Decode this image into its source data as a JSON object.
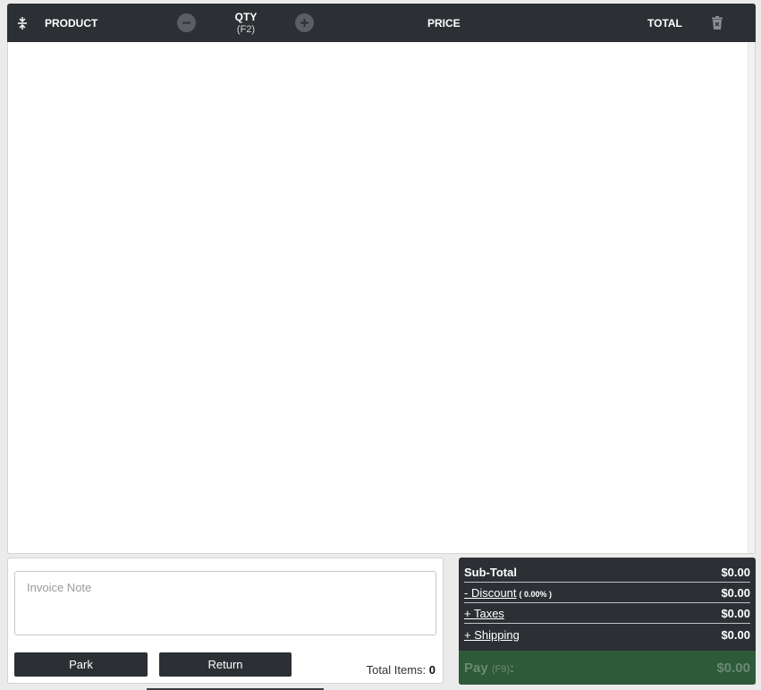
{
  "cart": {
    "header": {
      "product": "PRODUCT",
      "qty": "QTY",
      "qty_shortcut": "(F2)",
      "price": "PRICE",
      "total": "TOTAL"
    },
    "icons": {
      "collapse": "expand-collapse-icon",
      "qty_minus": "minus-circle-icon",
      "qty_plus": "plus-circle-icon",
      "clear": "trash-icon"
    }
  },
  "notes": {
    "placeholder": "Invoice Note",
    "park_label": "Park",
    "return_label": "Return",
    "total_items_label": "Total Items:",
    "total_items_value": "0"
  },
  "totals": {
    "subtotal_label": "Sub-Total",
    "subtotal_value": "$0.00",
    "discount_label": "- Discount",
    "discount_pct": "( 0.00% )",
    "discount_value": "$0.00",
    "taxes_label": "+ Taxes",
    "taxes_value": "$0.00",
    "shipping_label": "+ Shipping",
    "shipping_value": "$0.00",
    "pay_label": "Pay",
    "pay_shortcut": "(F9)",
    "pay_colon": ":",
    "pay_value": "$0.00"
  },
  "colors": {
    "header_bg": "#2c2f33",
    "pay_bg": "#2f5a3a"
  }
}
